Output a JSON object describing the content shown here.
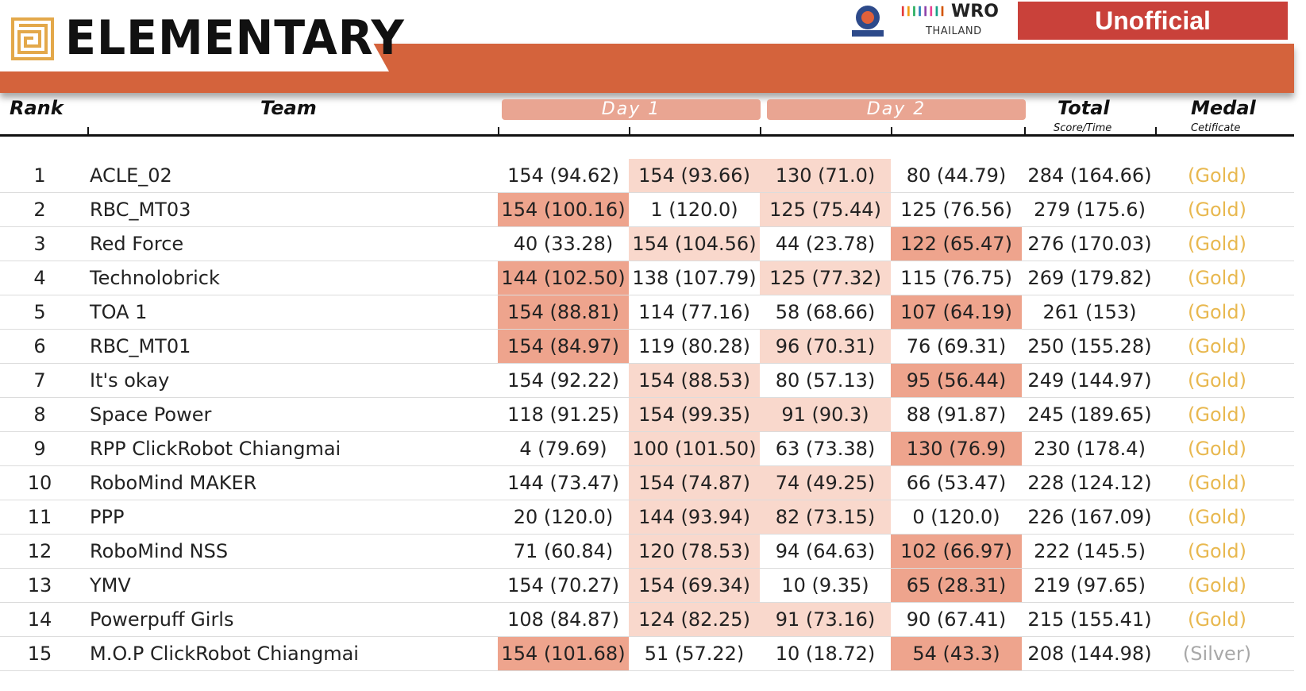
{
  "header": {
    "title": "ELEMENTARY",
    "status": "Unofficial",
    "sponsor_brand": "WRO",
    "sponsor_country": "THAILAND"
  },
  "columns": {
    "rank": "Rank",
    "team": "Team",
    "day1": "Day 1",
    "day2": "Day 2",
    "total": "Total",
    "total_sub": "Score/Time",
    "medal": "Medal",
    "medal_sub": "Cetificate"
  },
  "colors": {
    "accent_orange": "#d4633c",
    "badge_red": "#c9413a",
    "highlight_dark": "#eea48d",
    "highlight_light": "#f9d8cc",
    "gold": "#e8b84f",
    "silver": "#a8a8a8"
  },
  "rows": [
    {
      "rank": "1",
      "team": "ACLE_02",
      "r1": "154 (94.62)",
      "r2": "154 (93.66)",
      "r3": "130 (71.0)",
      "r4": "80 (44.79)",
      "total": "284 (164.66)",
      "medal": "(Gold)"
    },
    {
      "rank": "2",
      "team": "RBC_MT03",
      "r1": "154 (100.16)",
      "r2": "1 (120.0)",
      "r3": "125 (75.44)",
      "r4": "125 (76.56)",
      "total": "279 (175.6)",
      "medal": "(Gold)"
    },
    {
      "rank": "3",
      "team": "Red Force",
      "r1": "40 (33.28)",
      "r2": "154 (104.56)",
      "r3": "44 (23.78)",
      "r4": "122 (65.47)",
      "total": "276 (170.03)",
      "medal": "(Gold)"
    },
    {
      "rank": "4",
      "team": "Technolobrick",
      "r1": "144 (102.50)",
      "r2": "138 (107.79)",
      "r3": "125 (77.32)",
      "r4": "115 (76.75)",
      "total": "269 (179.82)",
      "medal": "(Gold)"
    },
    {
      "rank": "5",
      "team": "TOA 1",
      "r1": "154 (88.81)",
      "r2": "114 (77.16)",
      "r3": "58 (68.66)",
      "r4": "107 (64.19)",
      "total": "261 (153)",
      "medal": "(Gold)"
    },
    {
      "rank": "6",
      "team": "RBC_MT01",
      "r1": "154 (84.97)",
      "r2": "119 (80.28)",
      "r3": "96 (70.31)",
      "r4": "76 (69.31)",
      "total": "250 (155.28)",
      "medal": "(Gold)"
    },
    {
      "rank": "7",
      "team": "It's okay",
      "r1": "154 (92.22)",
      "r2": "154 (88.53)",
      "r3": "80 (57.13)",
      "r4": "95 (56.44)",
      "total": "249 (144.97)",
      "medal": "(Gold)"
    },
    {
      "rank": "8",
      "team": "Space Power",
      "r1": "118 (91.25)",
      "r2": "154 (99.35)",
      "r3": "91 (90.3)",
      "r4": "88 (91.87)",
      "total": "245 (189.65)",
      "medal": "(Gold)"
    },
    {
      "rank": "9",
      "team": "RPP ClickRobot Chiangmai",
      "r1": "4 (79.69)",
      "r2": "100 (101.50)",
      "r3": "63 (73.38)",
      "r4": "130 (76.9)",
      "total": "230 (178.4)",
      "medal": "(Gold)"
    },
    {
      "rank": "10",
      "team": "RoboMind MAKER",
      "r1": "144 (73.47)",
      "r2": "154 (74.87)",
      "r3": "74 (49.25)",
      "r4": "66 (53.47)",
      "total": "228 (124.12)",
      "medal": "(Gold)"
    },
    {
      "rank": "11",
      "team": "PPP",
      "r1": "20 (120.0)",
      "r2": "144 (93.94)",
      "r3": "82 (73.15)",
      "r4": "0 (120.0)",
      "total": "226 (167.09)",
      "medal": "(Gold)"
    },
    {
      "rank": "12",
      "team": "RoboMind NSS",
      "r1": "71 (60.84)",
      "r2": "120 (78.53)",
      "r3": "94 (64.63)",
      "r4": "102 (66.97)",
      "total": "222 (145.5)",
      "medal": "(Gold)"
    },
    {
      "rank": "13",
      "team": "YMV",
      "r1": "154 (70.27)",
      "r2": "154 (69.34)",
      "r3": "10 (9.35)",
      "r4": "65 (28.31)",
      "total": "219 (97.65)",
      "medal": "(Gold)"
    },
    {
      "rank": "14",
      "team": "Powerpuff Girls",
      "r1": "108 (84.87)",
      "r2": "124 (82.25)",
      "r3": "91 (73.16)",
      "r4": "90 (67.41)",
      "total": "215 (155.41)",
      "medal": "(Gold)"
    },
    {
      "rank": "15",
      "team": "M.O.P ClickRobot Chiangmai",
      "r1": "154 (101.68)",
      "r2": "51 (57.22)",
      "r3": "10 (18.72)",
      "r4": "54 (43.3)",
      "total": "208 (144.98)",
      "medal": "(Silver)"
    }
  ]
}
